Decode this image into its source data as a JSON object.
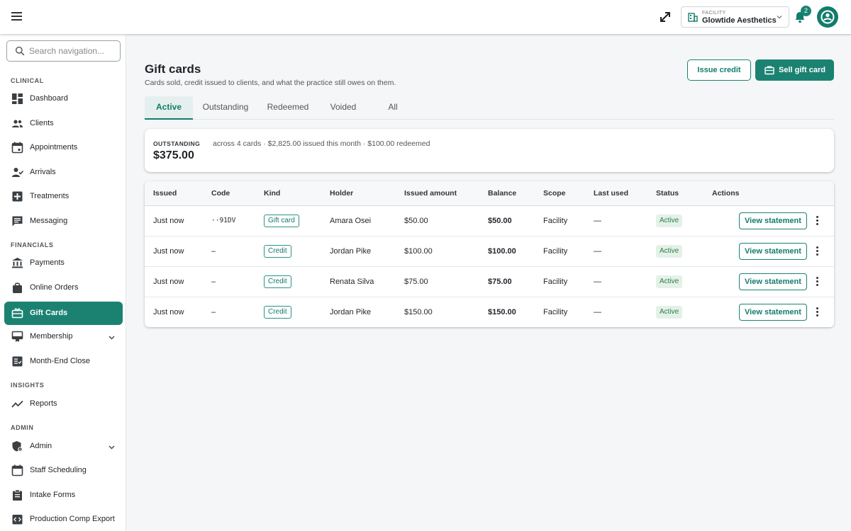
{
  "topbar": {
    "facility_label": "FACILITY",
    "facility_name": "Glowtide Aesthetics",
    "notification_count": "2"
  },
  "sidebar": {
    "search_placeholder": "Search navigation...",
    "sections": {
      "clinical": "CLINICAL",
      "financials": "FINANCIALS",
      "insights": "INSIGHTS",
      "admin": "ADMIN"
    },
    "items": [
      {
        "label": "Dashboard",
        "icon": "dashboard-icon"
      },
      {
        "label": "Clients",
        "icon": "people-icon"
      },
      {
        "label": "Appointments",
        "icon": "calendar-icon"
      },
      {
        "label": "Arrivals",
        "icon": "person-check-icon"
      },
      {
        "label": "Treatments",
        "icon": "medical-plus-icon"
      },
      {
        "label": "Messaging",
        "icon": "message-icon"
      },
      {
        "label": "Payments",
        "icon": "bank-icon"
      },
      {
        "label": "Online Orders",
        "icon": "shopping-bag-icon"
      },
      {
        "label": "Gift Cards",
        "icon": "gift-card-icon",
        "active": true
      },
      {
        "label": "Membership",
        "icon": "membership-icon"
      },
      {
        "label": "Month-End Close",
        "icon": "checklist-icon"
      },
      {
        "label": "Reports",
        "icon": "trend-icon"
      },
      {
        "label": "Admin",
        "icon": "admin-shield-icon"
      },
      {
        "label": "Staff Scheduling",
        "icon": "schedule-icon"
      },
      {
        "label": "Intake Forms",
        "icon": "clipboard-icon"
      },
      {
        "label": "Production Comp Export",
        "icon": "export-icon"
      }
    ]
  },
  "main": {
    "title": "Gift cards",
    "subtitle": "Cards sold, credit issued to clients, and what the practice still owes on them.",
    "issue_credit_label": "Issue credit",
    "sell_gift_card_label": "Sell gift card",
    "tabs": [
      "Active",
      "Outstanding",
      "Redeemed",
      "Voided",
      "All"
    ],
    "active_tab": "Active",
    "summary": {
      "label": "OUTSTANDING",
      "value": "$375.00",
      "detail": "across 4 cards · $2,825.00 issued this month · $100.00 redeemed"
    },
    "table": {
      "columns": [
        "Issued",
        "Code",
        "Kind",
        "Holder",
        "Issued amount",
        "Balance",
        "Scope",
        "Last used",
        "Status",
        "Actions"
      ],
      "action_label": "View statement",
      "rows": [
        {
          "issued": "Just now",
          "code": "··91DV",
          "kind": "Gift card",
          "holder": "Amara Osei",
          "amount": "$50.00",
          "balance": "$50.00",
          "scope": "Facility",
          "last_used": "—",
          "status": "Active"
        },
        {
          "issued": "Just now",
          "code": "–",
          "kind": "Credit",
          "holder": "Jordan Pike",
          "amount": "$100.00",
          "balance": "$100.00",
          "scope": "Facility",
          "last_used": "—",
          "status": "Active"
        },
        {
          "issued": "Just now",
          "code": "–",
          "kind": "Credit",
          "holder": "Renata Silva",
          "amount": "$75.00",
          "balance": "$75.00",
          "scope": "Facility",
          "last_used": "—",
          "status": "Active"
        },
        {
          "issued": "Just now",
          "code": "–",
          "kind": "Credit",
          "holder": "Jordan Pike",
          "amount": "$150.00",
          "balance": "$150.00",
          "scope": "Facility",
          "last_used": "—",
          "status": "Active"
        }
      ]
    }
  },
  "colors": {
    "accent": "#1b8272",
    "accent_dark": "#137c6c",
    "status_bg": "#e4f1e8",
    "status_text": "#2e7d46"
  }
}
